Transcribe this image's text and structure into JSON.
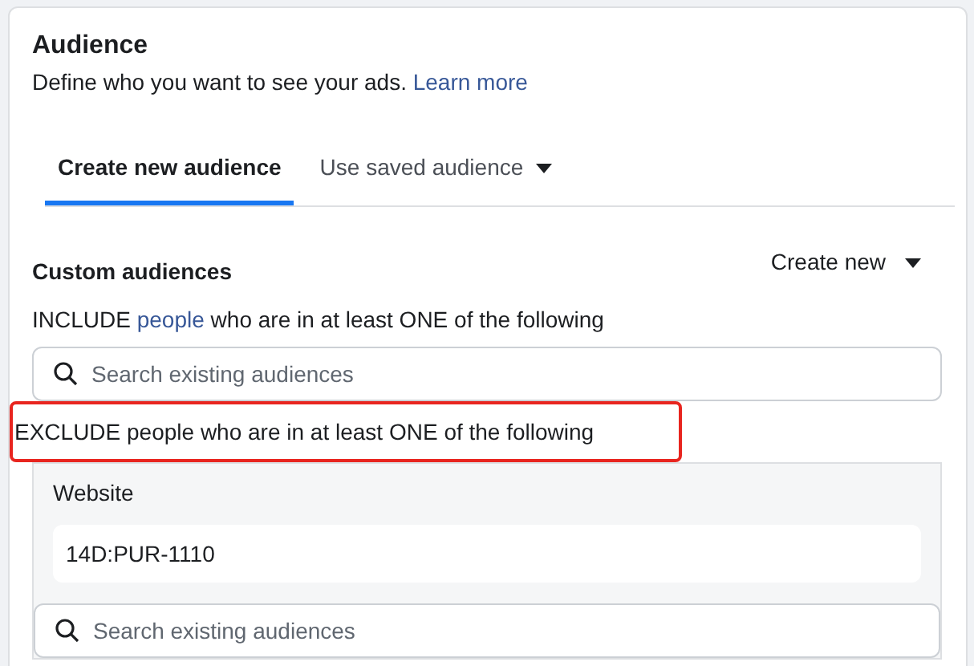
{
  "section": {
    "title": "Audience",
    "subtitle": "Define who you want to see your ads.",
    "subtitle_link": "Learn more"
  },
  "tabs": [
    {
      "label": "Create new audience",
      "selected": true,
      "dropdown": false
    },
    {
      "label": "Use saved audience",
      "selected": false,
      "dropdown": true
    }
  ],
  "custom_audiences": {
    "title": "Custom audiences",
    "create_button": "Create new",
    "include": {
      "prefix": "INCLUDE",
      "link": "people",
      "suffix": "who are in at least ONE of the following",
      "search_placeholder": "Search existing audiences"
    },
    "exclude": {
      "text": "EXCLUDE people who are in at least ONE of the following",
      "highlighted": true,
      "group_label": "Website",
      "audience": "14D:PUR-1110",
      "search_placeholder": "Search existing audiences"
    }
  }
}
